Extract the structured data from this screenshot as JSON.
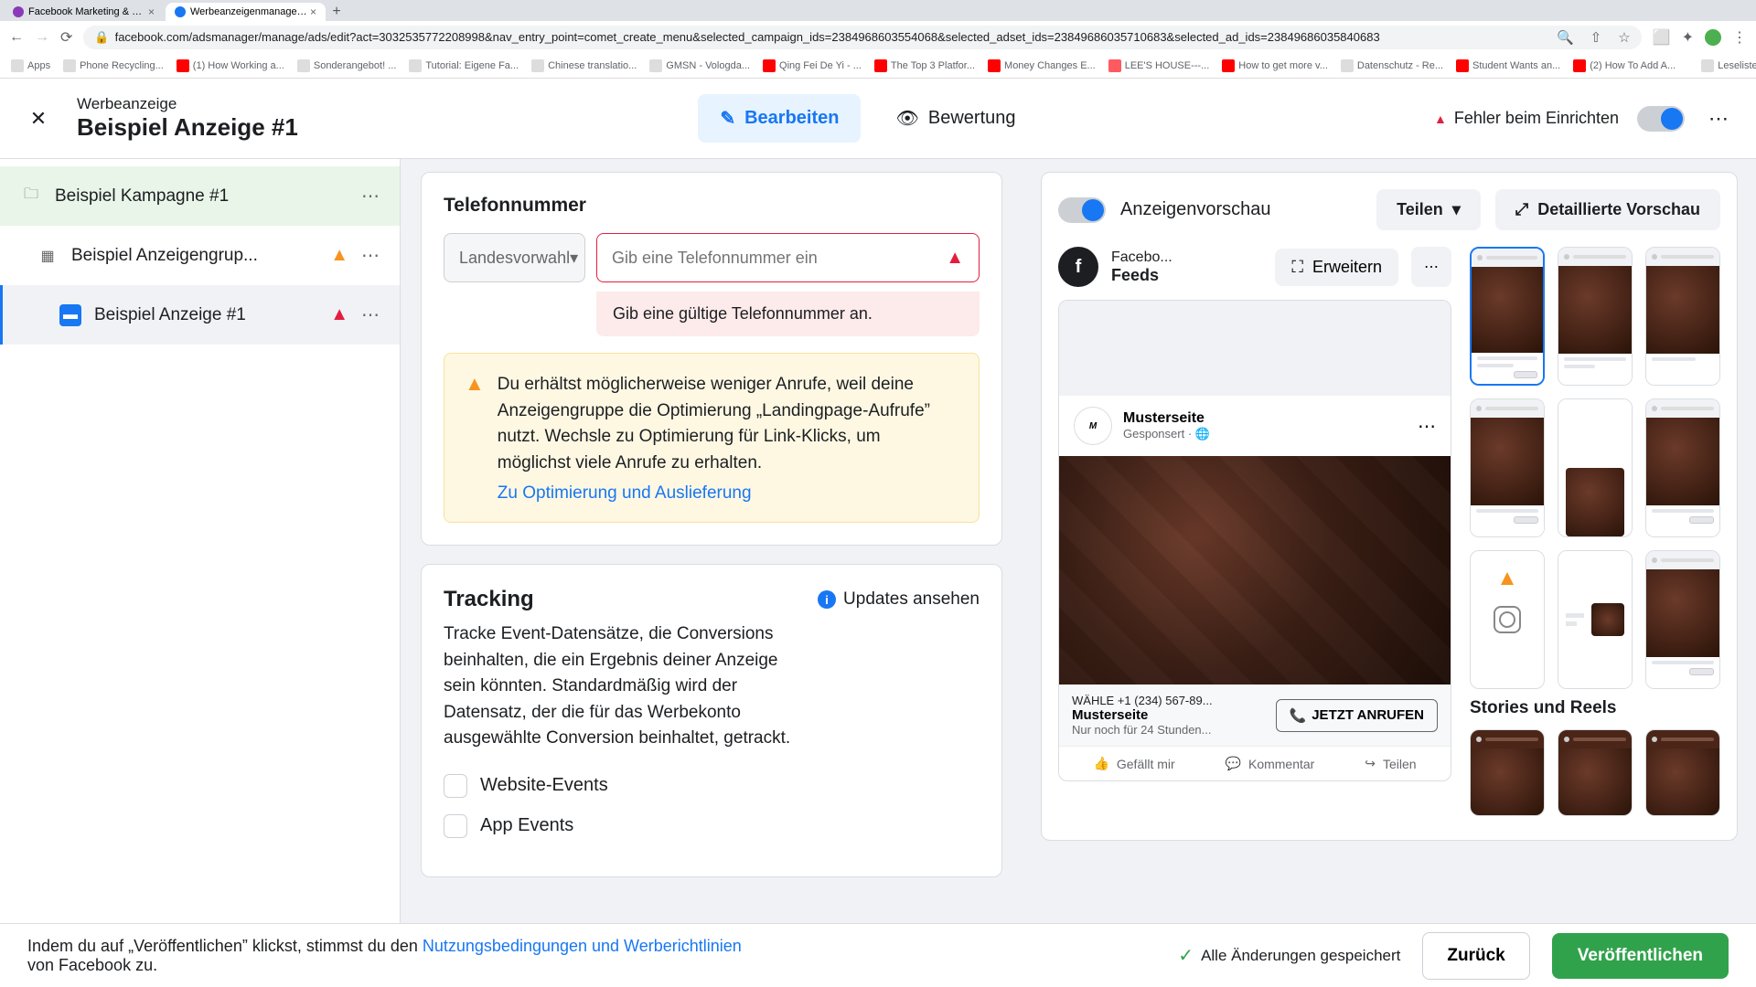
{
  "browser": {
    "tabs": [
      {
        "title": "Facebook Marketing & Werbe..."
      },
      {
        "title": "Werbeanzeigenmanager - We..."
      }
    ],
    "url": "facebook.com/adsmanager/manage/ads/edit?act=3032535772208998&nav_entry_point=comet_create_menu&selected_campaign_ids=2384968603554068&selected_adset_ids=23849686035710683&selected_ad_ids=23849686035840683",
    "bookmarks": [
      {
        "label": "Apps"
      },
      {
        "label": "Phone Recycling..."
      },
      {
        "label": "(1) How Working a..."
      },
      {
        "label": "Sonderangebot! ..."
      },
      {
        "label": "Tutorial: Eigene Fa..."
      },
      {
        "label": "Chinese translatio..."
      },
      {
        "label": "GMSN - Vologda..."
      },
      {
        "label": "Qing Fei De Yi - ..."
      },
      {
        "label": "The Top 3 Platfor..."
      },
      {
        "label": "Money Changes E..."
      },
      {
        "label": "LEE'S HOUSE---..."
      },
      {
        "label": "How to get more v..."
      },
      {
        "label": "Datenschutz - Re..."
      },
      {
        "label": "Student Wants an..."
      },
      {
        "label": "(2) How To Add A..."
      },
      {
        "label": "Leseliste"
      }
    ]
  },
  "header": {
    "subtitle": "Werbeanzeige",
    "title": "Beispiel Anzeige #1",
    "edit_label": "Bearbeiten",
    "review_label": "Bewertung",
    "status_error": "Fehler beim Einrichten"
  },
  "sidebar": {
    "items": [
      {
        "label": "Beispiel Kampagne #1"
      },
      {
        "label": "Beispiel Anzeigengrup..."
      },
      {
        "label": "Beispiel Anzeige #1"
      }
    ]
  },
  "phone": {
    "section_label": "Telefonnummer",
    "country_label": "Landesvorwahl",
    "input_placeholder": "Gib eine Telefonnummer ein",
    "error_msg": "Gib eine gültige Telefonnummer an.",
    "warn_text": "Du erhältst möglicherweise weniger Anrufe, weil deine Anzeigengruppe die Optimierung „Landingpage-Aufrufe” nutzt. Wechsle zu Optimierung für Link-Klicks, um möglichst viele Anrufe zu erhalten.",
    "warn_link": "Zu Optimierung und Auslieferung"
  },
  "tracking": {
    "title": "Tracking",
    "updates_label": "Updates ansehen",
    "desc": "Tracke Event-Datensätze, die Conversions beinhalten, die ein Ergebnis deiner Anzeige sein könnten. Standardmäßig wird der Datensatz, der die für das Werbekonto ausgewählte Conversion beinhaltet, getrackt.",
    "options": [
      {
        "label": "Website-Events"
      },
      {
        "label": "App Events"
      }
    ]
  },
  "preview": {
    "title": "Anzeigenvorschau",
    "share_label": "Teilen",
    "detail_label": "Detaillierte Vorschau",
    "tab_small": "Facebo...",
    "tab_big": "Feeds",
    "expand_label": "Erweitern",
    "mock": {
      "page_name": "Musterseite",
      "sponsored": "Gesponsert",
      "globe": "🌐",
      "cta_line1": "WÄHLE +1 (234) 567-89...",
      "cta_line2": "Musterseite",
      "cta_line3": "Nur noch für 24 Stunden...",
      "cta_btn": "JETZT ANRUFEN",
      "like": "Gefällt mir",
      "comment": "Kommentar",
      "share": "Teilen"
    },
    "section2_title": "Stories und Reels"
  },
  "footer": {
    "text_prefix": "Indem du auf „Veröffentlichen” klickst, stimmst du den ",
    "link1": "Nutzungsbedingungen und Werberichtlinien",
    "text_suffix": " von Facebook zu.",
    "saved_label": "Alle Änderungen gespeichert",
    "back_label": "Zurück",
    "publish_label": "Veröffentlichen"
  }
}
